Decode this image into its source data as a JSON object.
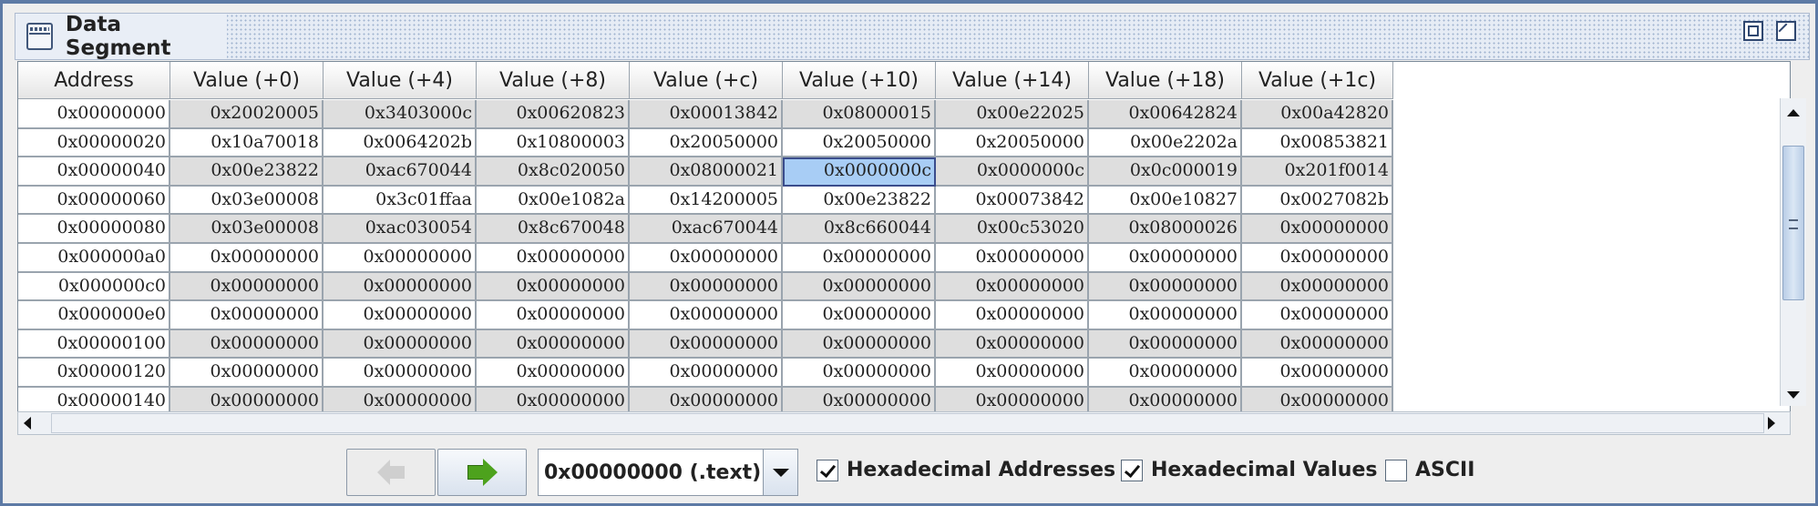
{
  "window": {
    "title": "Data Segment",
    "icon": "window-icon",
    "buttons": [
      "minimize-icon",
      "maximize-icon"
    ]
  },
  "table": {
    "columns": [
      "Address",
      "Value (+0)",
      "Value (+4)",
      "Value (+8)",
      "Value (+c)",
      "Value (+10)",
      "Value (+14)",
      "Value (+18)",
      "Value (+1c)"
    ],
    "rows": [
      [
        "0x00000000",
        "0x20020005",
        "0x3403000c",
        "0x00620823",
        "0x00013842",
        "0x08000015",
        "0x00e22025",
        "0x00642824",
        "0x00a42820"
      ],
      [
        "0x00000020",
        "0x10a70018",
        "0x0064202b",
        "0x10800003",
        "0x20050000",
        "0x20050000",
        "0x20050000",
        "0x00e2202a",
        "0x00853821"
      ],
      [
        "0x00000040",
        "0x00e23822",
        "0xac670044",
        "0x8c020050",
        "0x08000021",
        "0x0000000c",
        "0x0000000c",
        "0x0c000019",
        "0x201f0014"
      ],
      [
        "0x00000060",
        "0x03e00008",
        "0x3c01ffaa",
        "0x00e1082a",
        "0x14200005",
        "0x00e23822",
        "0x00073842",
        "0x00e10827",
        "0x0027082b"
      ],
      [
        "0x00000080",
        "0x03e00008",
        "0xac030054",
        "0x8c670048",
        "0xac670044",
        "0x8c660044",
        "0x00c53020",
        "0x08000026",
        "0x00000000"
      ],
      [
        "0x000000a0",
        "0x00000000",
        "0x00000000",
        "0x00000000",
        "0x00000000",
        "0x00000000",
        "0x00000000",
        "0x00000000",
        "0x00000000"
      ],
      [
        "0x000000c0",
        "0x00000000",
        "0x00000000",
        "0x00000000",
        "0x00000000",
        "0x00000000",
        "0x00000000",
        "0x00000000",
        "0x00000000"
      ],
      [
        "0x000000e0",
        "0x00000000",
        "0x00000000",
        "0x00000000",
        "0x00000000",
        "0x00000000",
        "0x00000000",
        "0x00000000",
        "0x00000000"
      ],
      [
        "0x00000100",
        "0x00000000",
        "0x00000000",
        "0x00000000",
        "0x00000000",
        "0x00000000",
        "0x00000000",
        "0x00000000",
        "0x00000000"
      ],
      [
        "0x00000120",
        "0x00000000",
        "0x00000000",
        "0x00000000",
        "0x00000000",
        "0x00000000",
        "0x00000000",
        "0x00000000",
        "0x00000000"
      ],
      [
        "0x00000140",
        "0x00000000",
        "0x00000000",
        "0x00000000",
        "0x00000000",
        "0x00000000",
        "0x00000000",
        "0x00000000",
        "0x00000000"
      ]
    ],
    "selected_cell": {
      "row": 2,
      "col": 5
    },
    "colors": {
      "alt_row": "#dedede",
      "selection": "#a8cdf5",
      "grid": "#9aa4ae"
    }
  },
  "controls": {
    "prev_button_icon": "arrow-left-icon",
    "next_button_icon": "arrow-right-icon",
    "segment_select": {
      "value": "0x00000000 (.text)"
    },
    "hex_addresses": {
      "label": "Hexadecimal Addresses",
      "checked": true
    },
    "hex_values": {
      "label": "Hexadecimal Values",
      "checked": true
    },
    "ascii": {
      "label": "ASCII",
      "checked": false
    }
  }
}
